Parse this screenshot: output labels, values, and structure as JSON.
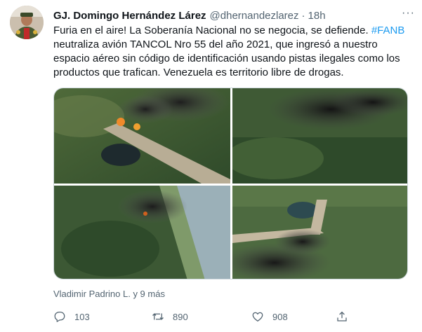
{
  "tweet": {
    "author_name": "GJ. Domingo Hernández Lárez",
    "author_handle": "@dhernandezlarez",
    "separator": "·",
    "time": "18h",
    "more_label": "···",
    "text_main": "Furia en el aire! La Soberanía Nacional no se negocia, se defiende. ",
    "hashtag": "#FANB",
    "text_rest": " neutraliza avión TANCOL Nro 55 del año 2021, que ingresó a nuestro espacio aéreo sin código de identificación usando pistas ilegales como los productos que trafican. Venezuela es territorio libre de drogas.",
    "tagged": "Vladimir Padrino L. y 9 más"
  },
  "actions": {
    "reply_count": "103",
    "retweet_count": "890",
    "like_count": "908"
  },
  "icons": {
    "reply": "reply-icon",
    "retweet": "retweet-icon",
    "like": "heart-icon",
    "share": "share-icon",
    "more": "more-icon"
  },
  "colors": {
    "link": "#1d9bf0",
    "secondary_text": "#536471",
    "primary_text": "#0f1419"
  }
}
